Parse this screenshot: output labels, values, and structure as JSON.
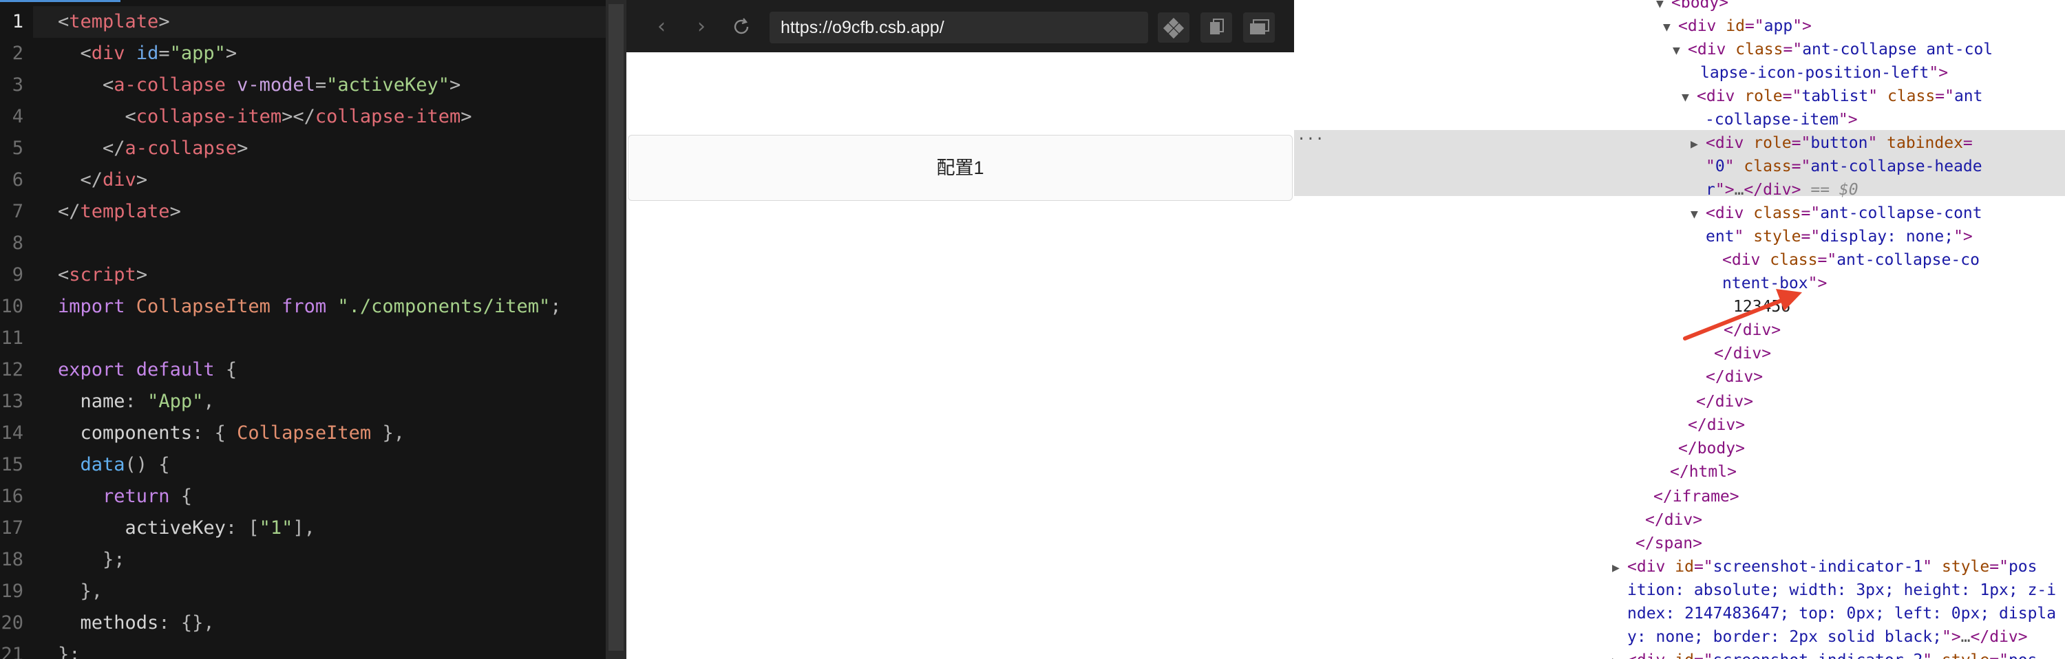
{
  "editor": {
    "lines": [
      [
        {
          "t": "<",
          "c": "t-brk"
        },
        {
          "t": "template",
          "c": "t-tag"
        },
        {
          "t": ">",
          "c": "t-brk"
        }
      ],
      [
        {
          "t": "  <",
          "c": "t-brk"
        },
        {
          "t": "div",
          "c": "t-tag"
        },
        {
          "t": " id",
          "c": "t-attrb"
        },
        {
          "t": "=",
          "c": "t-pun"
        },
        {
          "t": "\"app\"",
          "c": "t-str"
        },
        {
          "t": ">",
          "c": "t-brk"
        }
      ],
      [
        {
          "t": "    <",
          "c": "t-brk"
        },
        {
          "t": "a-collapse",
          "c": "t-tag"
        },
        {
          "t": " v-model",
          "c": "t-attr"
        },
        {
          "t": "=",
          "c": "t-pun"
        },
        {
          "t": "\"activeKey\"",
          "c": "t-str"
        },
        {
          "t": ">",
          "c": "t-brk"
        }
      ],
      [
        {
          "t": "      <",
          "c": "t-brk"
        },
        {
          "t": "collapse-item",
          "c": "t-tag"
        },
        {
          "t": "></",
          "c": "t-brk"
        },
        {
          "t": "collapse-item",
          "c": "t-tag"
        },
        {
          "t": ">",
          "c": "t-brk"
        }
      ],
      [
        {
          "t": "    </",
          "c": "t-brk"
        },
        {
          "t": "a-collapse",
          "c": "t-tag"
        },
        {
          "t": ">",
          "c": "t-brk"
        }
      ],
      [
        {
          "t": "  </",
          "c": "t-brk"
        },
        {
          "t": "div",
          "c": "t-tag"
        },
        {
          "t": ">",
          "c": "t-brk"
        }
      ],
      [
        {
          "t": "</",
          "c": "t-brk"
        },
        {
          "t": "template",
          "c": "t-tag"
        },
        {
          "t": ">",
          "c": "t-brk"
        }
      ],
      [],
      [
        {
          "t": "<",
          "c": "t-brk"
        },
        {
          "t": "script",
          "c": "t-tag"
        },
        {
          "t": ">",
          "c": "t-brk"
        }
      ],
      [
        {
          "t": "import ",
          "c": "t-kw"
        },
        {
          "t": "CollapseItem ",
          "c": "t-cls"
        },
        {
          "t": "from ",
          "c": "t-kw"
        },
        {
          "t": "\"./components/item\"",
          "c": "t-str"
        },
        {
          "t": ";",
          "c": "t-pun"
        }
      ],
      [],
      [
        {
          "t": "export ",
          "c": "t-kw"
        },
        {
          "t": "default ",
          "c": "t-kw"
        },
        {
          "t": "{",
          "c": "t-pun"
        }
      ],
      [
        {
          "t": "  name",
          "c": "t-prop"
        },
        {
          "t": ": ",
          "c": "t-pun"
        },
        {
          "t": "\"App\"",
          "c": "t-str"
        },
        {
          "t": ",",
          "c": "t-pun"
        }
      ],
      [
        {
          "t": "  components",
          "c": "t-prop"
        },
        {
          "t": ": { ",
          "c": "t-pun"
        },
        {
          "t": "CollapseItem",
          "c": "t-cls"
        },
        {
          "t": " },",
          "c": "t-pun"
        }
      ],
      [
        {
          "t": "  data",
          "c": "t-fn"
        },
        {
          "t": "() {",
          "c": "t-pun"
        }
      ],
      [
        {
          "t": "    return ",
          "c": "t-kw"
        },
        {
          "t": "{",
          "c": "t-pun"
        }
      ],
      [
        {
          "t": "      activeKey",
          "c": "t-prop"
        },
        {
          "t": ": [",
          "c": "t-pun"
        },
        {
          "t": "\"1\"",
          "c": "t-str"
        },
        {
          "t": "],",
          "c": "t-pun"
        }
      ],
      [
        {
          "t": "    };",
          "c": "t-pun"
        }
      ],
      [
        {
          "t": "  },",
          "c": "t-pun"
        }
      ],
      [
        {
          "t": "  methods",
          "c": "t-prop"
        },
        {
          "t": ": {},",
          "c": "t-pun"
        }
      ],
      [
        {
          "t": "};",
          "c": "t-pun"
        }
      ]
    ]
  },
  "browser": {
    "url": "https://o9cfb.csb.app/",
    "back_icon": "chevron-left-icon",
    "forward_icon": "chevron-right-icon",
    "reload_icon": "reload-icon",
    "collapse_header": "配置1"
  },
  "devtools": {
    "selected_ref": "== $0",
    "lines": [
      {
        "tri": "▼",
        "seg": [
          {
            "t": "<",
            "c": "d-tag"
          },
          {
            "t": "body",
            "c": "d-tag"
          },
          {
            "t": ">",
            "c": "d-tag"
          }
        ]
      },
      {
        "tri": "▼",
        "seg": [
          {
            "t": "<div ",
            "c": "d-tag"
          },
          {
            "t": "id",
            "c": "d-an"
          },
          {
            "t": "=\"",
            "c": "d-tag"
          },
          {
            "t": "app",
            "c": "d-av"
          },
          {
            "t": "\">",
            "c": "d-tag"
          }
        ]
      },
      {
        "tri": "▼",
        "seg": [
          {
            "t": "<div ",
            "c": "d-tag"
          },
          {
            "t": "class",
            "c": "d-an"
          },
          {
            "t": "=\"",
            "c": "d-tag"
          },
          {
            "t": "ant-collapse ant-col",
            "c": "d-av"
          }
        ]
      },
      {
        "tri": "",
        "seg": [
          {
            "t": "lapse-icon-position-left",
            "c": "d-av"
          },
          {
            "t": "\">",
            "c": "d-tag"
          }
        ]
      },
      {
        "tri": "▼",
        "seg": [
          {
            "t": "<div ",
            "c": "d-tag"
          },
          {
            "t": "role",
            "c": "d-an"
          },
          {
            "t": "=\"",
            "c": "d-tag"
          },
          {
            "t": "tablist",
            "c": "d-av"
          },
          {
            "t": "\" ",
            "c": "d-tag"
          },
          {
            "t": "class",
            "c": "d-an"
          },
          {
            "t": "=\"",
            "c": "d-tag"
          },
          {
            "t": "ant",
            "c": "d-av"
          }
        ]
      },
      {
        "tri": "",
        "seg": [
          {
            "t": "-collapse-item",
            "c": "d-av"
          },
          {
            "t": "\">",
            "c": "d-tag"
          }
        ]
      },
      {
        "tri": "▶",
        "seg": [
          {
            "t": "<div ",
            "c": "d-tag"
          },
          {
            "t": "role",
            "c": "d-an"
          },
          {
            "t": "=\"",
            "c": "d-tag"
          },
          {
            "t": "button",
            "c": "d-av"
          },
          {
            "t": "\" ",
            "c": "d-tag"
          },
          {
            "t": "tabindex",
            "c": "d-an"
          },
          {
            "t": "=",
            "c": "d-tag"
          }
        ]
      },
      {
        "tri": "",
        "seg": [
          {
            "t": "\"",
            "c": "d-tag"
          },
          {
            "t": "0",
            "c": "d-av"
          },
          {
            "t": "\" ",
            "c": "d-tag"
          },
          {
            "t": "class",
            "c": "d-an"
          },
          {
            "t": "=\"",
            "c": "d-tag"
          },
          {
            "t": "ant-collapse-heade",
            "c": "d-av"
          }
        ]
      },
      {
        "tri": "",
        "seg": [
          {
            "t": "r",
            "c": "d-av"
          },
          {
            "t": "\">",
            "c": "d-tag"
          },
          {
            "t": "…",
            "c": "d-dim"
          },
          {
            "t": "</div>",
            "c": "d-tag"
          },
          {
            "t": " == $0",
            "c": "d-ref"
          }
        ]
      },
      {
        "tri": "▼",
        "seg": [
          {
            "t": "<div ",
            "c": "d-tag"
          },
          {
            "t": "class",
            "c": "d-an"
          },
          {
            "t": "=\"",
            "c": "d-tag"
          },
          {
            "t": "ant-collapse-cont",
            "c": "d-av"
          }
        ]
      },
      {
        "tri": "",
        "seg": [
          {
            "t": "ent",
            "c": "d-av"
          },
          {
            "t": "\" ",
            "c": "d-tag"
          },
          {
            "t": "style",
            "c": "d-an"
          },
          {
            "t": "=\"",
            "c": "d-tag"
          },
          {
            "t": "display: none;",
            "c": "d-av"
          },
          {
            "t": "\">",
            "c": "d-tag"
          }
        ]
      },
      {
        "tri": "",
        "seg": [
          {
            "t": "<div ",
            "c": "d-tag"
          },
          {
            "t": "class",
            "c": "d-an"
          },
          {
            "t": "=\"",
            "c": "d-tag"
          },
          {
            "t": "ant-collapse-co",
            "c": "d-av"
          }
        ]
      },
      {
        "tri": "",
        "seg": [
          {
            "t": "ntent-box",
            "c": "d-av"
          },
          {
            "t": "\">",
            "c": "d-tag"
          }
        ]
      },
      {
        "tri": "",
        "seg": [
          {
            "t": "123456",
            "c": "d-txt"
          }
        ]
      },
      {
        "tri": "",
        "seg": [
          {
            "t": "</div>",
            "c": "d-tag"
          }
        ]
      },
      {
        "tri": "",
        "seg": [
          {
            "t": "</div>",
            "c": "d-tag"
          }
        ]
      },
      {
        "tri": "",
        "seg": [
          {
            "t": "</div>",
            "c": "d-tag"
          }
        ]
      },
      {
        "tri": "",
        "seg": [
          {
            "t": "</div>",
            "c": "d-tag"
          }
        ]
      },
      {
        "tri": "",
        "seg": [
          {
            "t": "</div>",
            "c": "d-tag"
          }
        ]
      },
      {
        "tri": "",
        "seg": [
          {
            "t": "</body>",
            "c": "d-tag"
          }
        ]
      },
      {
        "tri": "",
        "seg": [
          {
            "t": "</html>",
            "c": "d-tag"
          }
        ]
      },
      {
        "tri": "",
        "seg": [
          {
            "t": "</iframe>",
            "c": "d-tag"
          }
        ]
      },
      {
        "tri": "",
        "seg": [
          {
            "t": "</div>",
            "c": "d-tag"
          }
        ]
      },
      {
        "tri": "",
        "seg": [
          {
            "t": "</span>",
            "c": "d-tag"
          }
        ]
      },
      {
        "tri": "▶",
        "seg": [
          {
            "t": "<div ",
            "c": "d-tag"
          },
          {
            "t": "id",
            "c": "d-an"
          },
          {
            "t": "=\"",
            "c": "d-tag"
          },
          {
            "t": "screenshot-indicator-1",
            "c": "d-av"
          },
          {
            "t": "\" ",
            "c": "d-tag"
          },
          {
            "t": "style",
            "c": "d-an"
          },
          {
            "t": "=\"",
            "c": "d-tag"
          },
          {
            "t": "pos",
            "c": "d-av"
          }
        ]
      },
      {
        "tri": "",
        "seg": [
          {
            "t": "ition: absolute; width: 3px; height: 1px; z-i",
            "c": "d-av"
          }
        ]
      },
      {
        "tri": "",
        "seg": [
          {
            "t": "ndex: 2147483647; top: 0px; left: 0px; displa",
            "c": "d-av"
          }
        ]
      },
      {
        "tri": "",
        "seg": [
          {
            "t": "y: none; border: 2px solid black;",
            "c": "d-av"
          },
          {
            "t": "\">",
            "c": "d-tag"
          },
          {
            "t": "…",
            "c": "d-dim"
          },
          {
            "t": "</div>",
            "c": "d-tag"
          }
        ]
      },
      {
        "tri": "▶",
        "seg": [
          {
            "t": "<div ",
            "c": "d-tag"
          },
          {
            "t": "id",
            "c": "d-an"
          },
          {
            "t": "=\"",
            "c": "d-tag"
          },
          {
            "t": "screenshot-indicator-2",
            "c": "d-av"
          },
          {
            "t": "\" ",
            "c": "d-tag"
          },
          {
            "t": "style",
            "c": "d-an"
          },
          {
            "t": "=\"",
            "c": "d-tag"
          },
          {
            "t": "pos",
            "c": "d-av"
          }
        ]
      }
    ]
  }
}
